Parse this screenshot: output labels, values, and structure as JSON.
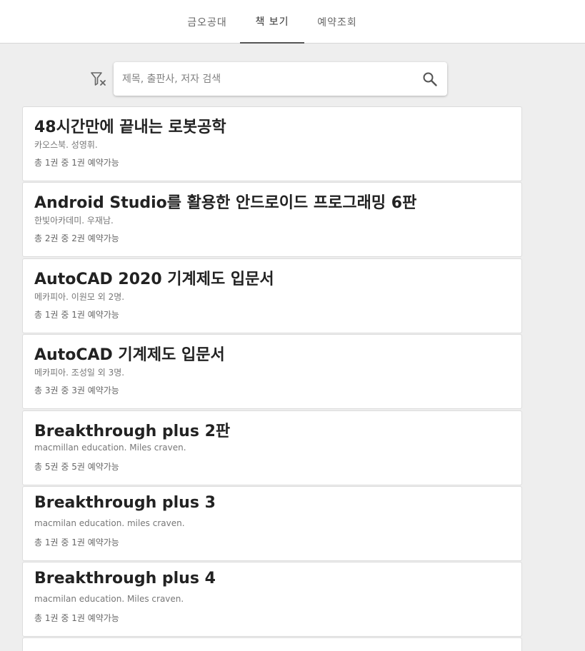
{
  "tabs": [
    {
      "label": "금오공대"
    },
    {
      "label": "책 보기"
    },
    {
      "label": "예약조회"
    }
  ],
  "search": {
    "placeholder": "제목, 출판사, 저자 검색",
    "value": ""
  },
  "icons": {
    "filter_clear": "filter-clear-icon",
    "search": "search-icon"
  },
  "books": [
    {
      "title": "48시간만에 끝내는 로봇공학",
      "author": "카오스북. 성영휘.",
      "availability": "총 1권 중 1권 예약가능"
    },
    {
      "title": "Android Studio를 활용한 안드로이드 프로그래밍 6판",
      "author": "한빛아카데미. 우재남.",
      "availability": "총 2권 중 2권 예약가능"
    },
    {
      "title": "AutoCAD 2020 기계제도 입문서",
      "author": "메카피아. 이원모 외 2명.",
      "availability": "총 1권 중 1권 예약가능"
    },
    {
      "title": "AutoCAD 기계제도 입문서",
      "author": "메카피아. 조성일 외 3명.",
      "availability": "총 3권 중 3권 예약가능"
    },
    {
      "title": "Breakthrough plus 2판",
      "author": "macmillan education. Miles craven.",
      "availability": "총 5권 중 5권 예약가능"
    },
    {
      "title": "Breakthrough plus 3",
      "author": "macmilan education. miles craven.",
      "availability": "총 1권 중 1권 예약가능"
    },
    {
      "title": "Breakthrough plus 4",
      "author": "macmilan education. Miles craven.",
      "availability": "총 1권 중 1권 예약가능"
    }
  ],
  "colors": {
    "background": "#eeeeee",
    "card": "#ffffff",
    "active_tab_indicator": "#555555"
  }
}
